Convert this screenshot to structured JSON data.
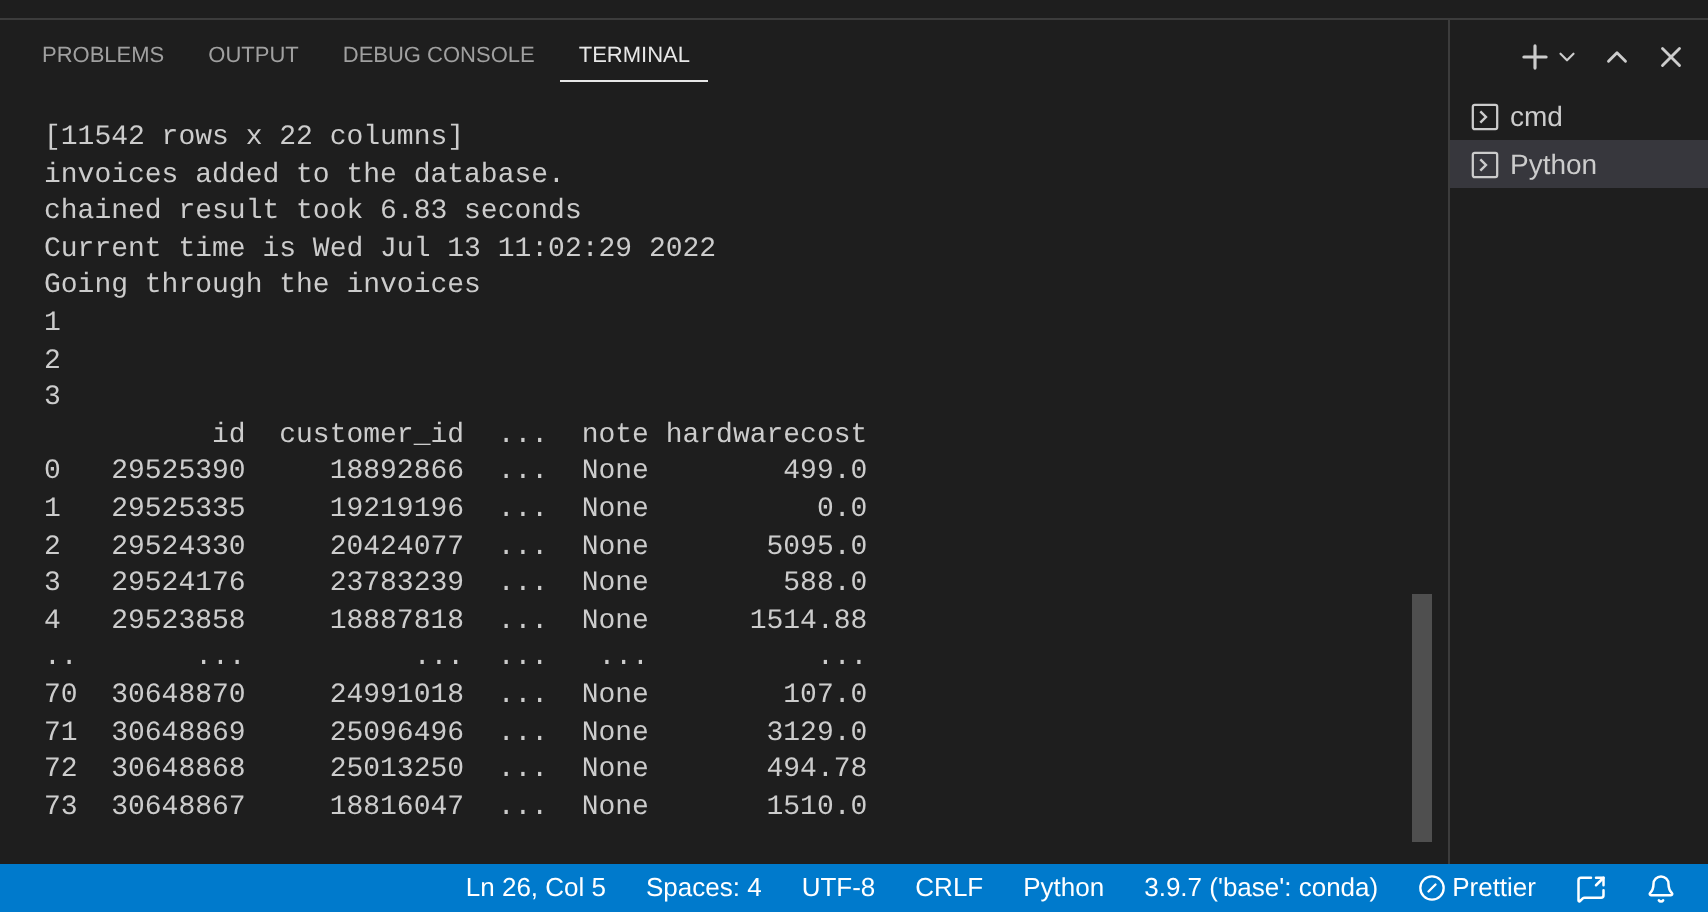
{
  "panel_tabs": [
    {
      "label": "PROBLEMS",
      "selected": false
    },
    {
      "label": "OUTPUT",
      "selected": false
    },
    {
      "label": "DEBUG CONSOLE",
      "selected": false
    },
    {
      "label": "TERMINAL",
      "selected": true
    }
  ],
  "terminal_lines": [
    "[11542 rows x 22 columns]",
    "invoices added to the database.",
    "chained result took 6.83 seconds",
    "Current time is Wed Jul 13 11:02:29 2022",
    "Going through the invoices",
    "1",
    "2",
    "3",
    "          id  customer_id  ...  note hardwarecost",
    "0   29525390     18892866  ...  None        499.0",
    "1   29525335     19219196  ...  None          0.0",
    "2   29524330     20424077  ...  None       5095.0",
    "3   29524176     23783239  ...  None        588.0",
    "4   29523858     18887818  ...  None      1514.88",
    "..       ...          ...  ...   ...          ...",
    "70  30648870     24991018  ...  None        107.0",
    "71  30648869     25096496  ...  None       3129.0",
    "72  30648868     25013250  ...  None       494.78",
    "73  30648867     18816047  ...  None       1510.0"
  ],
  "terminals": [
    {
      "label": "cmd",
      "selected": false
    },
    {
      "label": "Python",
      "selected": true
    }
  ],
  "status_bar": [
    {
      "kind": "text",
      "label": "Ln 26, Col 5"
    },
    {
      "kind": "text",
      "label": "Spaces: 4"
    },
    {
      "kind": "text",
      "label": "UTF-8"
    },
    {
      "kind": "text",
      "label": "CRLF"
    },
    {
      "kind": "text",
      "label": "Python"
    },
    {
      "kind": "text",
      "label": "3.9.7 ('base': conda)"
    },
    {
      "kind": "prettier",
      "label": "Prettier"
    },
    {
      "kind": "feedback"
    },
    {
      "kind": "bell"
    }
  ]
}
